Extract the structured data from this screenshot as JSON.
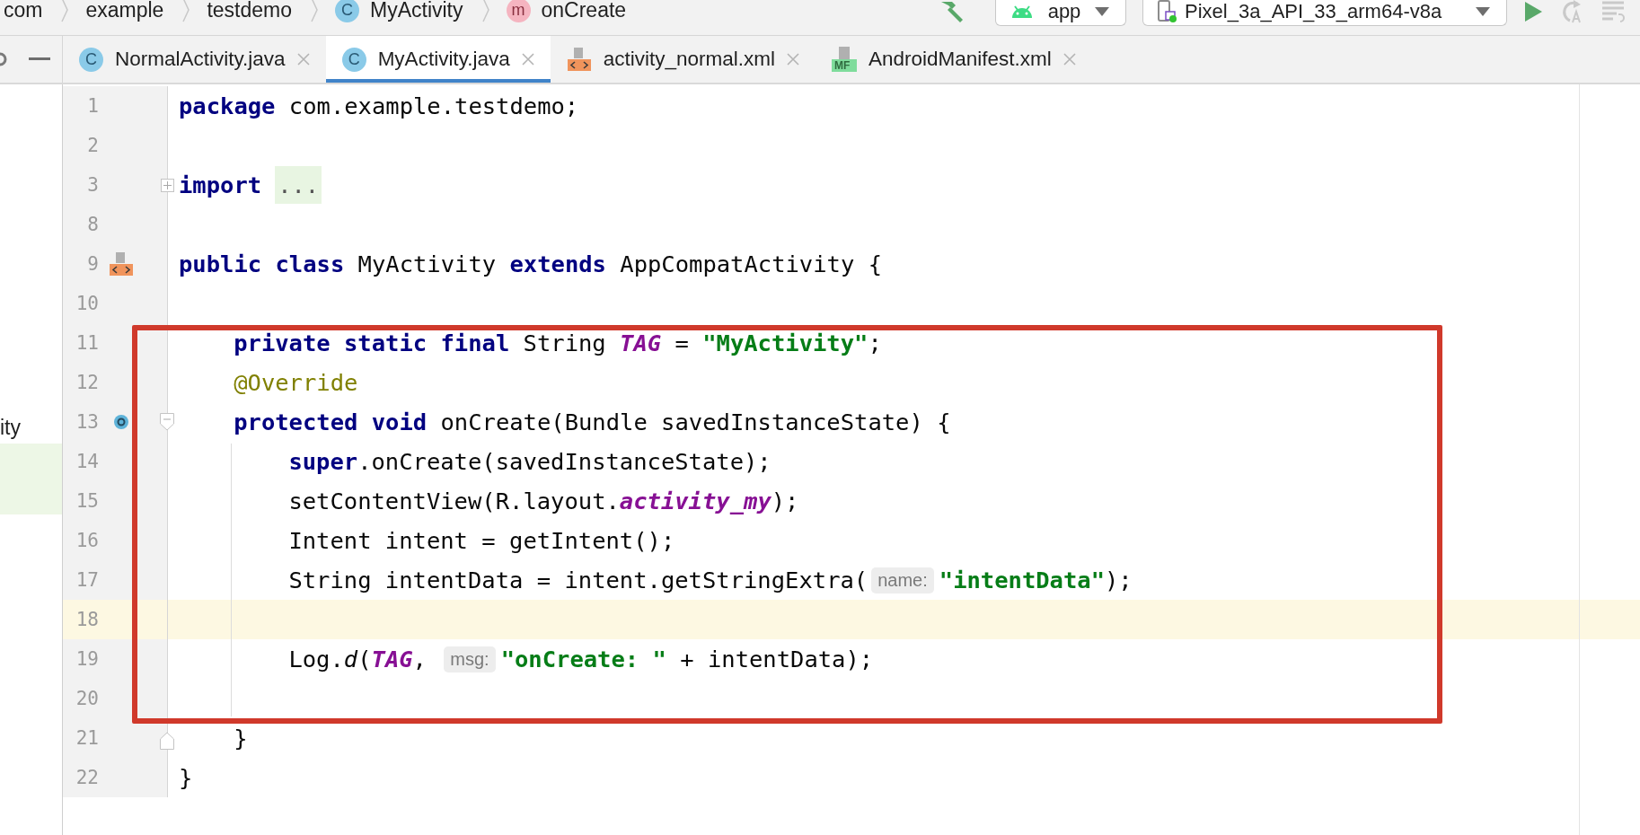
{
  "breadcrumbs": [
    {
      "label": "com",
      "kind": "package"
    },
    {
      "label": "example",
      "kind": "package"
    },
    {
      "label": "testdemo",
      "kind": "package"
    },
    {
      "label": "MyActivity",
      "kind": "class",
      "badge": "C"
    },
    {
      "label": "onCreate",
      "kind": "method",
      "badge": "m"
    }
  ],
  "toolbar": {
    "config": "app",
    "device": "Pixel_3a_API_33_arm64-v8a"
  },
  "tabs": [
    {
      "label": "NormalActivity.java",
      "kind": "class",
      "badge": "C",
      "selected": false
    },
    {
      "label": "MyActivity.java",
      "kind": "class",
      "badge": "C",
      "selected": true
    },
    {
      "label": "activity_normal.xml",
      "kind": "layout",
      "selected": false
    },
    {
      "label": "AndroidManifest.xml",
      "kind": "manifest",
      "badge": "MF",
      "selected": false
    }
  ],
  "project_panel": {
    "label": "ity"
  },
  "editor": {
    "lines": [
      {
        "number": "1",
        "current": false,
        "tokens": [
          {
            "kind": "kw",
            "text": "package"
          },
          {
            "kind": "plain",
            "text": " com.example.testdemo;"
          }
        ]
      },
      {
        "number": "2",
        "current": false
      },
      {
        "number": "3",
        "current": false,
        "fold": {
          "kind": "expand"
        },
        "tokens": [
          {
            "kind": "kw",
            "text": "import"
          },
          {
            "kind": "folded",
            "text": "..."
          }
        ]
      },
      {
        "number": "8",
        "current": false
      },
      {
        "number": "9",
        "current": false,
        "marker": {
          "kind": "layout"
        },
        "tokens": [
          {
            "kind": "kw",
            "text": "public class"
          },
          {
            "kind": "plain",
            "text": " MyActivity "
          },
          {
            "kind": "kw",
            "text": "extends"
          },
          {
            "kind": "plain",
            "text": " AppCompatActivity {"
          }
        ],
        "children": [
          {
            "number": "10",
            "current": false
          },
          {
            "number": "11",
            "current": false,
            "tokens": [
              {
                "kind": "kw",
                "text": "private static final"
              },
              {
                "kind": "plain",
                "text": " String "
              },
              {
                "kind": "field",
                "text": "TAG"
              },
              {
                "kind": "plain",
                "text": " = "
              },
              {
                "kind": "str",
                "text": "\"MyActivity\""
              },
              {
                "kind": "plain",
                "text": ";"
              }
            ]
          },
          {
            "number": "12",
            "current": false,
            "tokens": [
              {
                "kind": "ann",
                "text": "@Override"
              }
            ]
          },
          {
            "number": "13",
            "current": false,
            "marker": {
              "kind": "override"
            },
            "fold": {
              "kind": "collapse"
            },
            "tokens": [
              {
                "kind": "kw",
                "text": "protected void"
              },
              {
                "kind": "plain",
                "text": " onCreate(Bundle savedInstanceState) {"
              }
            ],
            "children": [
              {
                "number": "14",
                "current": false,
                "tokens": [
                  {
                    "kind": "kw",
                    "text": "super"
                  },
                  {
                    "kind": "plain",
                    "text": ".onCreate(savedInstanceState);"
                  }
                ]
              },
              {
                "number": "15",
                "current": false,
                "tokens": [
                  {
                    "kind": "plain",
                    "text": "setContentView(R.layout."
                  },
                  {
                    "kind": "field",
                    "text": "activity_my"
                  },
                  {
                    "kind": "plain",
                    "text": ");"
                  }
                ]
              },
              {
                "number": "16",
                "current": false,
                "tokens": [
                  {
                    "kind": "plain",
                    "text": "Intent intent = getIntent();"
                  }
                ]
              },
              {
                "number": "17",
                "current": false,
                "tokens": [
                  {
                    "kind": "plain",
                    "text": "String intentData = intent.getStringExtra("
                  },
                  {
                    "kind": "hint",
                    "text": "name:"
                  },
                  {
                    "kind": "str",
                    "text": "\"intentData\""
                  },
                  {
                    "kind": "plain",
                    "text": ");"
                  }
                ]
              },
              {
                "number": "18",
                "current": true
              },
              {
                "number": "19",
                "current": false,
                "tokens": [
                  {
                    "kind": "plain",
                    "text": "Log."
                  },
                  {
                    "kind": "static",
                    "text": "d"
                  },
                  {
                    "kind": "plain",
                    "text": "("
                  },
                  {
                    "kind": "field",
                    "text": "TAG"
                  },
                  {
                    "kind": "plain",
                    "text": ", "
                  },
                  {
                    "kind": "hint",
                    "text": "msg:"
                  },
                  {
                    "kind": "str",
                    "text": "\"onCreate: \""
                  },
                  {
                    "kind": "plain",
                    "text": " + intentData);"
                  }
                ]
              },
              {
                "number": "20",
                "current": false
              }
            ]
          },
          {
            "number": "21",
            "current": false,
            "fold": {
              "kind": "end"
            },
            "tokens": [
              {
                "kind": "plain",
                "text": "}"
              }
            ]
          }
        ]
      },
      {
        "number": "22",
        "current": false,
        "tokens": [
          {
            "kind": "plain",
            "text": "}"
          }
        ]
      }
    ]
  }
}
